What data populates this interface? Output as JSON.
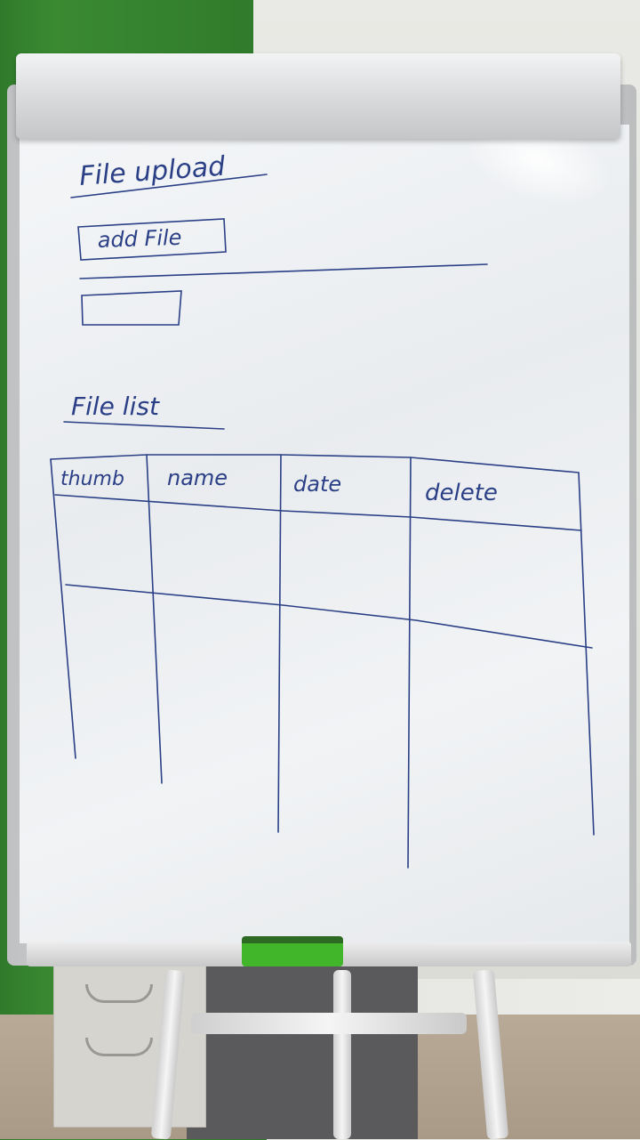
{
  "sketch": {
    "upload_title": "File upload",
    "add_file_button": "add File",
    "file_list_title": "File list",
    "table": {
      "columns": [
        "thumb",
        "name",
        "date",
        "delete"
      ],
      "rows": [
        [
          "",
          "",
          "",
          ""
        ],
        [
          "",
          "",
          "",
          ""
        ]
      ]
    }
  },
  "colors": {
    "ink": "#2a3f86",
    "board": "#eef0f2",
    "eraser": "#41b62b",
    "wall": "#2f7a2b"
  }
}
